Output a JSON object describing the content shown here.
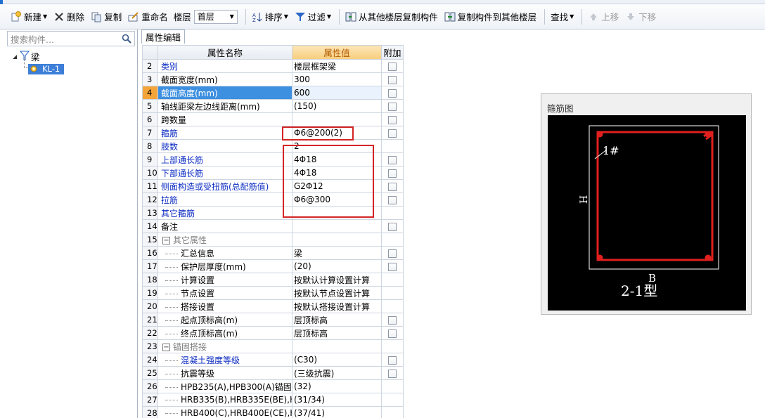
{
  "toolbar": {
    "new_label": "新建",
    "delete_label": "删除",
    "copy_label": "复制",
    "rename_label": "重命名",
    "floor_label": "楼层",
    "floor_value": "首层",
    "sort_label": "排序",
    "filter_label": "过滤",
    "copy_from_floor_label": "从其他楼层复制构件",
    "copy_to_floor_label": "复制构件到其他楼层",
    "find_label": "查找",
    "move_up_label": "上移",
    "move_down_label": "下移"
  },
  "left_panel": {
    "search_placeholder": "搜索构件...",
    "tree": {
      "root_label": "梁",
      "child_label": "KL-1"
    }
  },
  "tab": {
    "label": "属性编辑"
  },
  "grid": {
    "headers": {
      "name": "属性名称",
      "value": "属性值",
      "extra": "附加"
    },
    "rows": [
      {
        "num": "2",
        "name": "类别",
        "value": "楼层框架梁",
        "check": true,
        "style": "blue"
      },
      {
        "num": "3",
        "name": "截面宽度(mm)",
        "value": "300",
        "check": true,
        "style": "normal"
      },
      {
        "num": "4",
        "name": "截面高度(mm)",
        "value": "600",
        "check": true,
        "style": "selected"
      },
      {
        "num": "5",
        "name": "轴线距梁左边线距离(mm)",
        "value": "(150)",
        "check": true,
        "style": "normal"
      },
      {
        "num": "6",
        "name": "跨数量",
        "value": "",
        "check": true,
        "style": "normal"
      },
      {
        "num": "7",
        "name": "箍筋",
        "value": "Φ6@200(2)",
        "check": true,
        "style": "blue"
      },
      {
        "num": "8",
        "name": "肢数",
        "value": "2",
        "check": false,
        "style": "blue"
      },
      {
        "num": "9",
        "name": "上部通长筋",
        "value": "4Φ18",
        "check": true,
        "style": "blue"
      },
      {
        "num": "10",
        "name": "下部通长筋",
        "value": "4Φ18",
        "check": true,
        "style": "blue"
      },
      {
        "num": "11",
        "name": "侧面构造或受扭筋(总配筋值)",
        "value": "G2Φ12",
        "check": true,
        "style": "blue"
      },
      {
        "num": "12",
        "name": "拉筋",
        "value": "Φ6@300",
        "check": true,
        "style": "blue"
      },
      {
        "num": "13",
        "name": "其它箍筋",
        "value": "",
        "check": false,
        "style": "blue"
      },
      {
        "num": "14",
        "name": "备注",
        "value": "",
        "check": true,
        "style": "normal"
      },
      {
        "num": "15",
        "name": "其它属性",
        "value": "",
        "check": false,
        "style": "group"
      },
      {
        "num": "16",
        "name": "汇总信息",
        "value": "梁",
        "check": true,
        "style": "child"
      },
      {
        "num": "17",
        "name": "保护层厚度(mm)",
        "value": "(20)",
        "check": true,
        "style": "child"
      },
      {
        "num": "18",
        "name": "计算设置",
        "value": "按默认计算设置计算",
        "check": false,
        "style": "child"
      },
      {
        "num": "19",
        "name": "节点设置",
        "value": "按默认节点设置计算",
        "check": false,
        "style": "child"
      },
      {
        "num": "20",
        "name": "搭接设置",
        "value": "按默认搭接设置计算",
        "check": false,
        "style": "child"
      },
      {
        "num": "21",
        "name": "起点顶标高(m)",
        "value": "层顶标高",
        "check": true,
        "style": "child"
      },
      {
        "num": "22",
        "name": "终点顶标高(m)",
        "value": "层顶标高",
        "check": true,
        "style": "child"
      },
      {
        "num": "23",
        "name": "锚固搭接",
        "value": "",
        "check": false,
        "style": "group"
      },
      {
        "num": "24",
        "name": "混凝土强度等级",
        "value": "(C30)",
        "check": true,
        "style": "childblue"
      },
      {
        "num": "25",
        "name": "抗震等级",
        "value": "(三级抗震)",
        "check": true,
        "style": "child"
      },
      {
        "num": "26",
        "name": "HPB235(A),HPB300(A)锚固",
        "value": "(32)",
        "check": false,
        "style": "child"
      },
      {
        "num": "27",
        "name": "HRB335(B),HRB335E(BE),HRBF",
        "value": "(31/34)",
        "check": false,
        "style": "child"
      },
      {
        "num": "28",
        "name": "HRB400(C),HRB400E(CE),HRBF",
        "value": "(37/41)",
        "check": false,
        "style": "child"
      }
    ]
  },
  "stirrup": {
    "panel_title": "箍筋图",
    "bar_label": "1#",
    "height_label": "H",
    "width_label": "B",
    "type_label": "2-1型"
  },
  "colors": {
    "selection_blue": "#3d8fe0",
    "row_num_selected": "#f3a53a",
    "annotation_red": "#d42424",
    "stirrup_red": "#e0201e",
    "blue_text": "#0c2cc2"
  }
}
